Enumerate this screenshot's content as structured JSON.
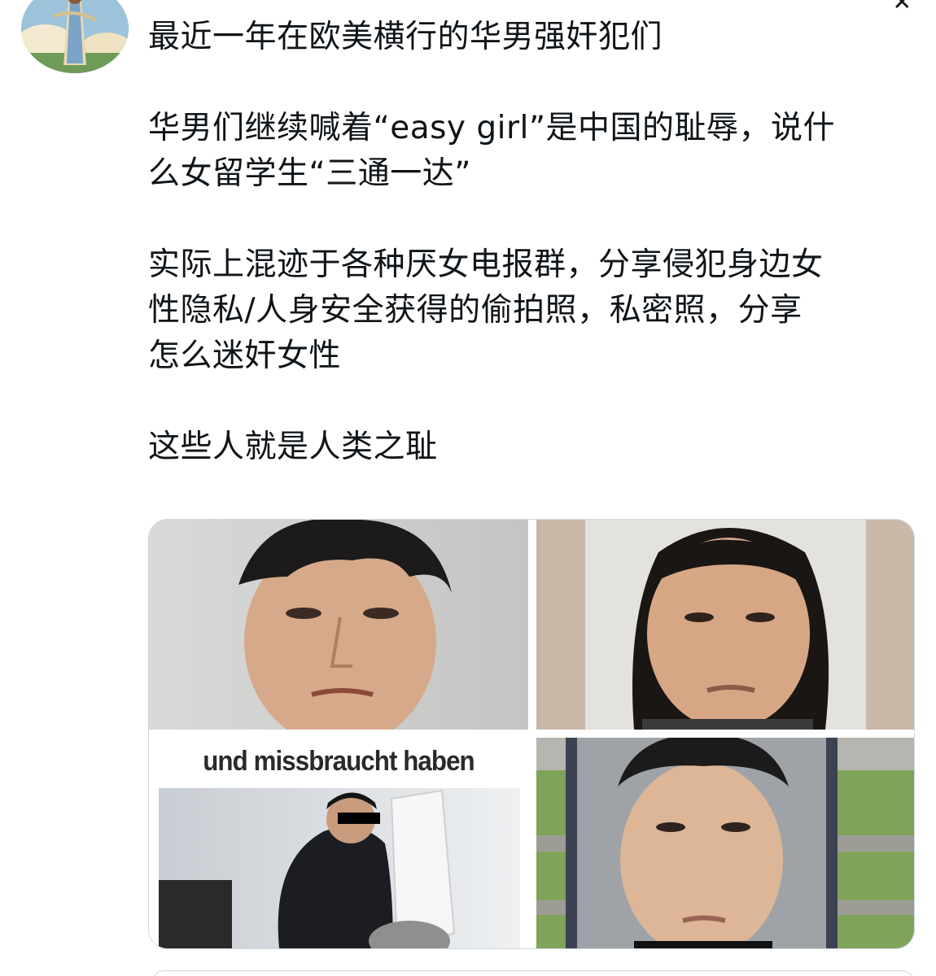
{
  "post": {
    "paragraphs": [
      "最近一年在欧美横行的华男强奸犯们",
      "华男们继续喊着“easy girl”是中国的耻辱，说什\n么女留学生“三通一达”",
      "实际上混迹于各种厌女电报群，分享侵犯身边女\n性隐私/人身安全获得的偷拍照，私密照，分享\n怎么迷奸女性",
      "这些人就是人类之耻"
    ]
  },
  "media": {
    "tile3_caption": "und missbraucht haben"
  },
  "icons": {
    "close": "close-icon"
  }
}
